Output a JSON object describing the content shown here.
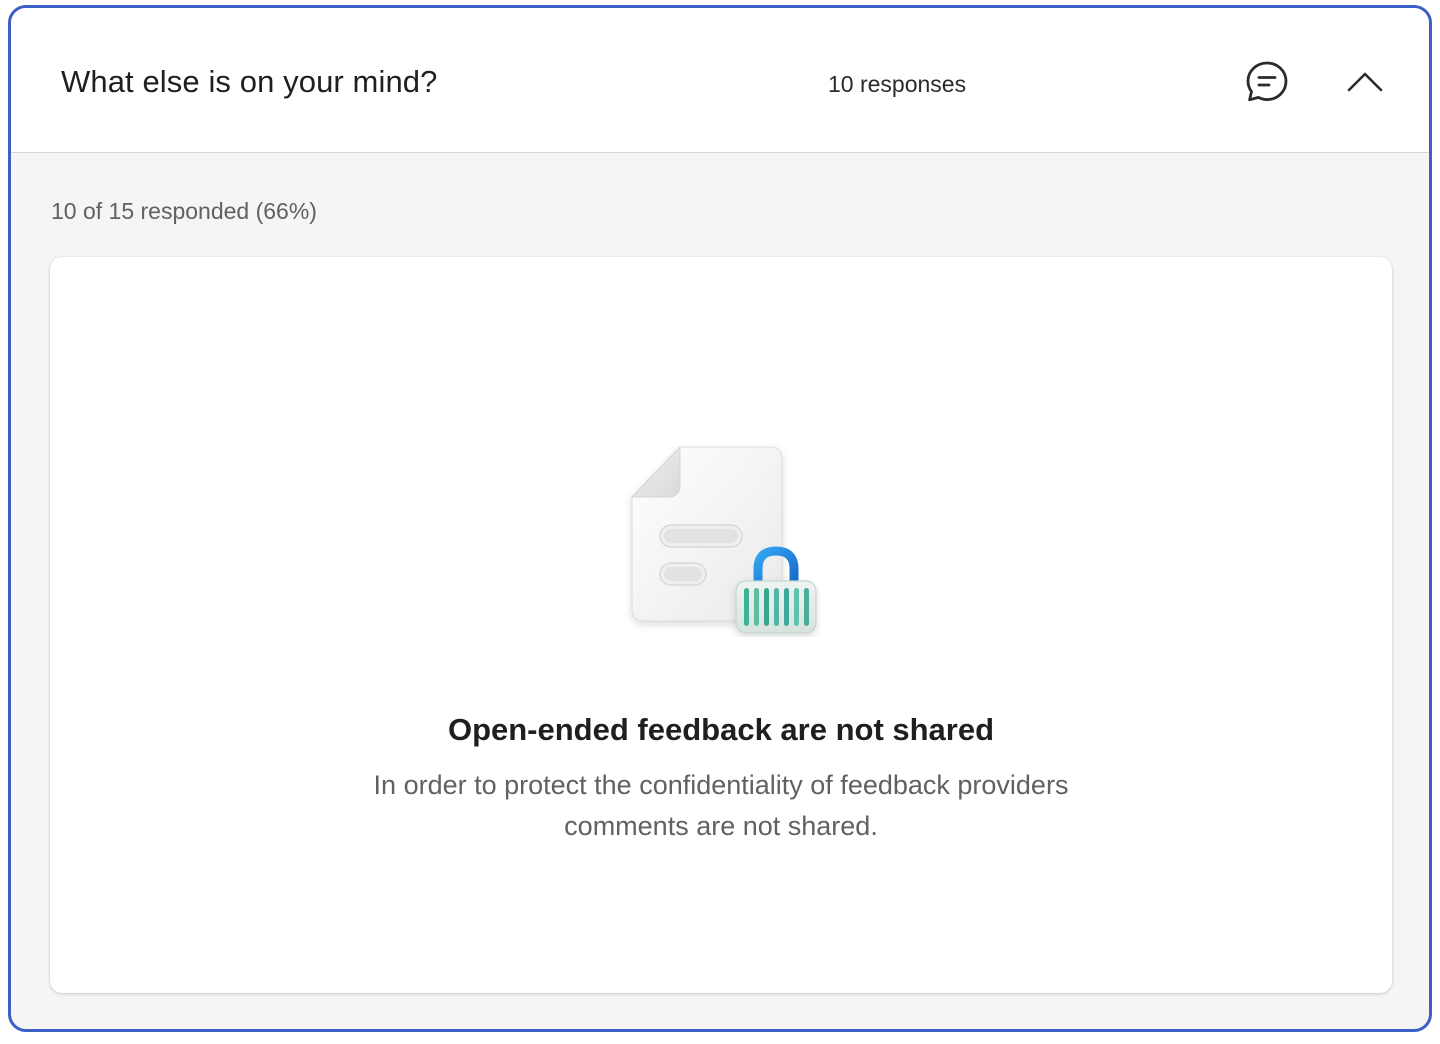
{
  "question": {
    "title": "What else is on your mind?",
    "responses_label": "10 responses"
  },
  "summary": {
    "respond_rate": "10 of 15 responded (66%)"
  },
  "empty_state": {
    "title": "Open-ended feedback are not shared",
    "description": "In order to protect the confidentiality of feedback providers comments are not shared."
  },
  "icons": {
    "comment": "comment-icon",
    "collapse": "chevron-up-icon",
    "illustration": "locked-document-illustration"
  },
  "colors": {
    "accent_border": "#3b5fc7",
    "lock_blue": "#1a8fe0",
    "lock_teal": "#3fb39a"
  }
}
